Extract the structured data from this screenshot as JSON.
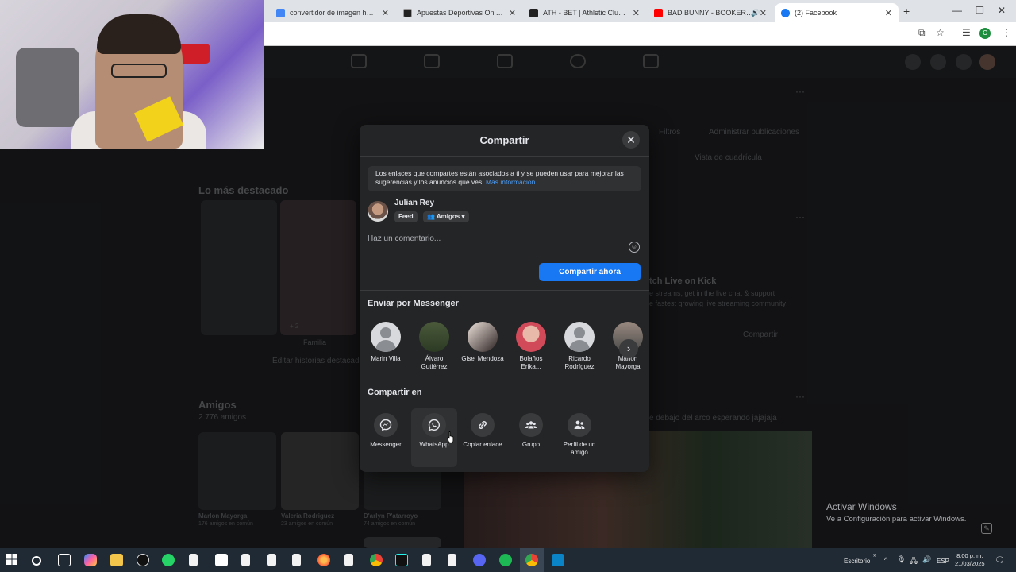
{
  "browser": {
    "tabs": [
      {
        "title": "convertidor de imagen hdmi a",
        "color": "#4285f4"
      },
      {
        "title": "Apuestas Deportivas Online - C",
        "color": "#222222"
      },
      {
        "title": "ATH - BET | Athletic Club vs Re",
        "color": "#222222"
      },
      {
        "title": "BAD BUNNY - BOOKER T (",
        "color": "#ff0000"
      },
      {
        "title": "(2) Facebook",
        "color": "#1877f2"
      }
    ],
    "profile_initial": "C"
  },
  "background_page": {
    "section_highlight": "Lo más destacado",
    "edit_highlights": "Editar historias destacadas",
    "highlight_label": "Familia",
    "highlight_count": "+ 2",
    "friends_heading": "Amigos",
    "friends_count": "2.776 amigos",
    "friends": [
      {
        "name": "Marlon Mayorga",
        "mutual": "176 amigos en común"
      },
      {
        "name": "Valeria Rodriguez",
        "mutual": "23 amigos en común"
      },
      {
        "name": "D'arlyn P'atarroyo",
        "mutual": "74 amigos en común"
      }
    ],
    "filters": "Filtros",
    "manage_posts": "Administrar publicaciones",
    "grid_view": "Vista de cuadrícula",
    "kick_title": "tch Live on Kick",
    "kick_line1": "e streams, get in the live chat & support",
    "kick_line2": "e fastest growing live streaming community!",
    "share_label": "Compartir",
    "post_caption": "e debajo del arco esperando jajajaja"
  },
  "modal": {
    "title": "Compartir",
    "close_label": "✕",
    "notice": "Los enlaces que compartes están asociados a ti y se pueden usar para mejorar las sugerencias y los anuncios que ves.",
    "notice_link": "Más información",
    "user_name": "Julian Rey",
    "feed_label": "Feed",
    "audience_label": "Amigos",
    "comment_placeholder": "Haz un comentario...",
    "share_now": "Compartir ahora",
    "messenger_heading": "Enviar por Messenger",
    "contacts": [
      {
        "name": "Marin Villa"
      },
      {
        "name": "Álvaro Gutiérrez"
      },
      {
        "name": "Gisel Mendoza"
      },
      {
        "name": "Bolaños Erika..."
      },
      {
        "name": "Ricardo Rodríguez"
      },
      {
        "name": "Marlon Mayorga"
      }
    ],
    "share_on_heading": "Compartir en",
    "share_targets": [
      {
        "label": "Messenger",
        "icon": "messenger-icon"
      },
      {
        "label": "WhatsApp",
        "icon": "whatsapp-icon"
      },
      {
        "label": "Copiar enlace",
        "icon": "link-icon"
      },
      {
        "label": "Grupo",
        "icon": "group-icon"
      },
      {
        "label": "Perfil de un amigo",
        "icon": "friend-profile-icon"
      }
    ]
  },
  "windows": {
    "activate_title": "Activar Windows",
    "activate_sub": "Ve a Configuración para activar Windows.",
    "desktop_label": "Escritorio",
    "language": "ESP",
    "time": "8:00 p. m.",
    "date": "21/03/2025"
  },
  "colors": {
    "accent": "#1877f2",
    "link": "#4b9cf7",
    "modal_bg": "#242526"
  }
}
